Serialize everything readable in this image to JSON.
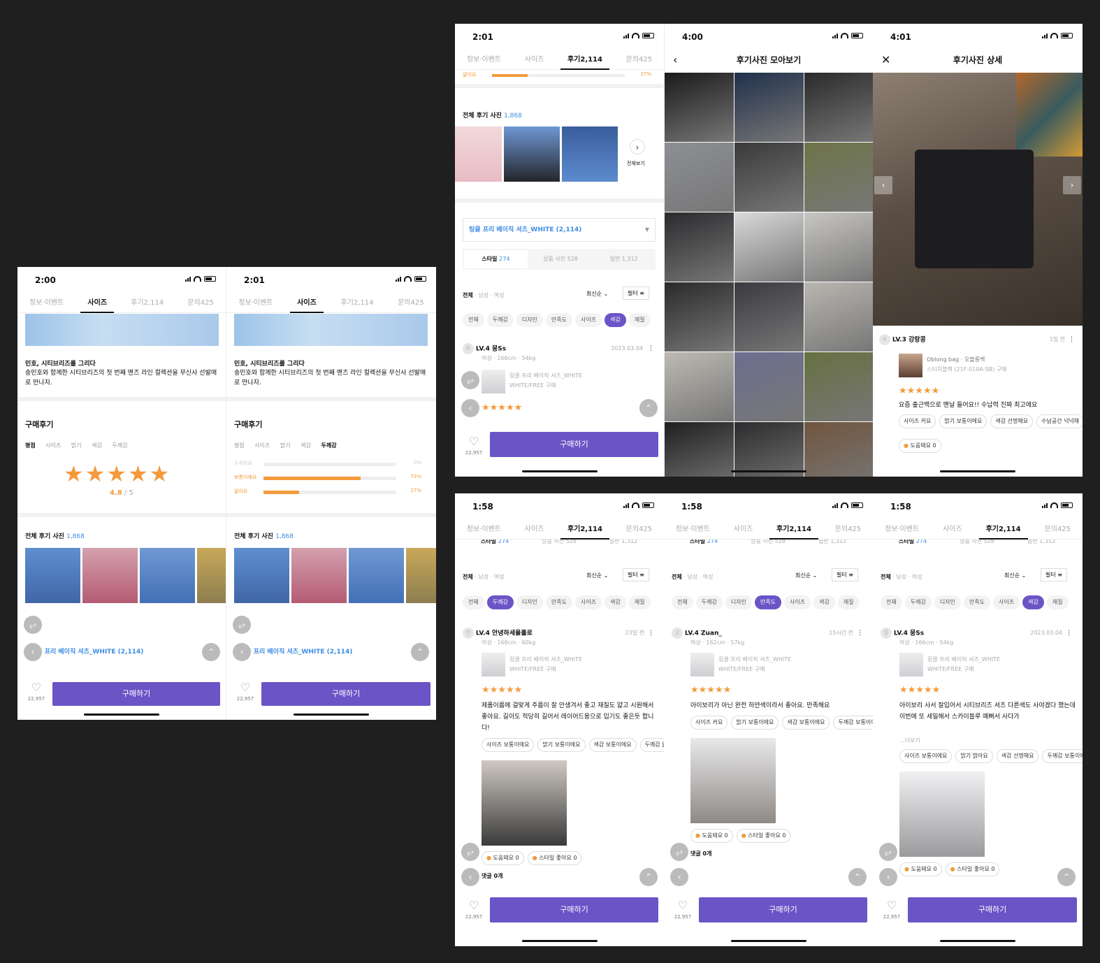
{
  "status": {
    "t200": "2:00",
    "t201": "2:01",
    "t400": "4:00",
    "t401": "4:01",
    "t158": "1:58"
  },
  "tabs": {
    "info": "정보·이벤트",
    "size": "사이즈",
    "review": "후기2,114",
    "qna": "문의425"
  },
  "story": {
    "title": "민호, 시티브리즈를 그리다",
    "desc": "송민호와 함께한 시티브리즈의 첫 번째 맨즈 라인 컬렉션을 무신사 선발매로 만나자."
  },
  "review_section": {
    "title": "구매후기",
    "tabs": [
      "평점",
      "사이즈",
      "밝기",
      "색감",
      "두께감"
    ],
    "rating": "4.8",
    "rating_max": "/ 5",
    "stars": "★★★★★"
  },
  "thickness": {
    "rows": [
      {
        "label": "두꺼워요",
        "pct": "0%",
        "value": 0
      },
      {
        "label": "보통이에요",
        "pct": "73%",
        "value": 0.73
      },
      {
        "label": "얇아요",
        "pct": "27%",
        "value": 0.27
      }
    ]
  },
  "photos": {
    "label": "전체 후기 사진",
    "count": "1,868",
    "see_all": "전체보기"
  },
  "product_select": "링클 프리 베이직 셔츠_WHITE (2,114)",
  "sub_tabs": [
    {
      "label": "스타일",
      "count": "274"
    },
    {
      "label": "상품 사진",
      "count": "528"
    },
    {
      "label": "일반",
      "count": "1,312"
    }
  ],
  "filters": {
    "all": "전체",
    "male": "남성",
    "female": "여성",
    "sort": "최신순",
    "filter": "필터"
  },
  "chips": [
    "전체",
    "두께감",
    "디자인",
    "만족도",
    "사이즈",
    "색감",
    "재질"
  ],
  "buy": {
    "label": "구매하기",
    "likes": "22,957"
  },
  "gallery": {
    "title": "후기사진 모아보기"
  },
  "detail": {
    "title": "후기사진 상세",
    "user": "LV.3 강랑콩",
    "when": "1일 전",
    "product": "Oblong bag · 오블롱백",
    "option": "스티치블랙 (21F-010A-SB) 구매",
    "text": "요즘 출근백으로 맨날 들어요!! 수납력 진짜 최고에요",
    "tags": [
      "사이즈 커요",
      "밝기 보통이에요",
      "색감 선명해요",
      "수납공간 넉넉해"
    ],
    "helpful": "도움돼요 0"
  },
  "reviews": [
    {
      "user": "LV.4 뭉Ss",
      "meta": "여성 · 166cm · 54kg",
      "date": "2023.03.04",
      "product": "링클 프리 베이직 셔츠_WHITE",
      "option": "WHITE/FREE 구매",
      "text": "아이보리 사서 잘입어서 시티브리즈 셔츠 다른색도 사야겠다 했는데 이번에 또 세일해서 스카이블루 예뻐서 사다가",
      "more": "...더보기",
      "tags": [
        "사이즈 보통이에요",
        "밝기 밝아요",
        "색감 선명해요",
        "두께감 보통이에"
      ],
      "helpful": "도움돼요 0",
      "style": "스타일 좋아요 0"
    },
    {
      "user": "LV.4 안녕하세율롤로",
      "meta": "여성 · 168cm · 60kg",
      "date": "23일 전",
      "product": "링클 프리 베이직 셔츠_WHITE",
      "option": "WHITE/FREE 구매",
      "text": "제품이름에 걸맞게 주름이 잘 안생겨서 좋고 재질도 얇고 시원해서 좋아요. 길이도 적당히 길어서 레이어드용으로 입기도 좋은듯 합니다!",
      "tags": [
        "사이즈 보통이에요",
        "밝기 보통이에요",
        "색감 보통이에요",
        "두께감 얇"
      ],
      "helpful": "도움돼요 0",
      "style": "스타일 좋아요 0",
      "comments": "댓글 0개"
    },
    {
      "user": "LV.4 Zuan_",
      "meta": "여성 · 162cm · 57kg",
      "date": "15시간 전",
      "product": "링클 프리 베이직 셔츠_WHITE",
      "option": "WHITE/FREE 구매",
      "text": "아이보리가 아닌 완전 하얀색이라서 좋아요. 만족해요",
      "tags": [
        "사이즈 커요",
        "밝기 보통이에요",
        "색감 보통이에요",
        "두께감 보통이에"
      ],
      "helpful": "도움돼요 0",
      "style": "스타일 좋아요 0",
      "comments": "댓글 0개"
    }
  ],
  "colors": {
    "accent": "#6b54c6",
    "star": "#f39a3c",
    "link": "#3d8ce6"
  },
  "icons": [
    "share-icon",
    "chevron-left-icon",
    "scroll-top-icon",
    "heart-icon",
    "close-icon",
    "chevron-down-icon",
    "filter-icon",
    "more-icon"
  ]
}
